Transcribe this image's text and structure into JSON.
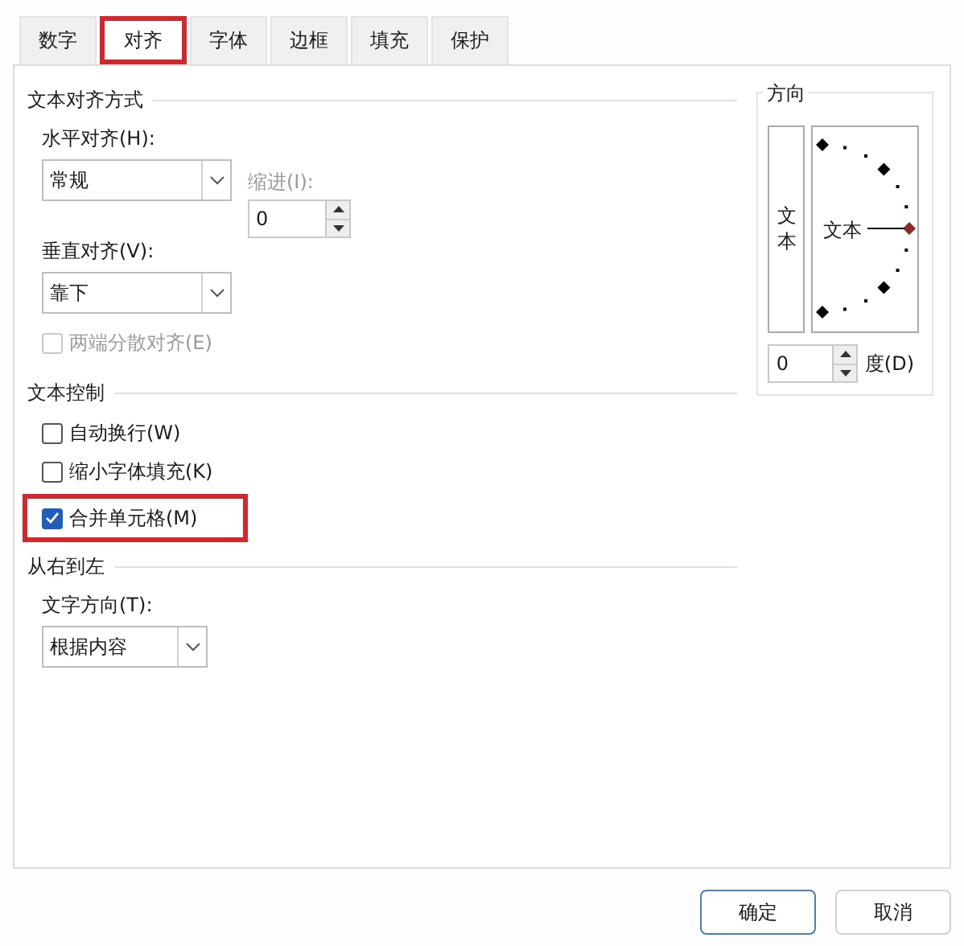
{
  "tabs": [
    {
      "label": "数字",
      "selected": false,
      "highlighted": false
    },
    {
      "label": "对齐",
      "selected": true,
      "highlighted": true
    },
    {
      "label": "字体",
      "selected": false,
      "highlighted": false
    },
    {
      "label": "边框",
      "selected": false,
      "highlighted": false
    },
    {
      "label": "填充",
      "selected": false,
      "highlighted": false
    },
    {
      "label": "保护",
      "selected": false,
      "highlighted": false
    }
  ],
  "text_alignment": {
    "title": "文本对齐方式",
    "horizontal": {
      "label": "水平对齐(H):",
      "value": "常规"
    },
    "indent": {
      "label": "缩进(I):",
      "value": "0",
      "disabled": true
    },
    "vertical": {
      "label": "垂直对齐(V):",
      "value": "靠下"
    },
    "distributed": {
      "label": "两端分散对齐(E)",
      "checked": false,
      "disabled": true,
      "highlighted": false
    }
  },
  "text_control": {
    "title": "文本控制",
    "options": [
      {
        "label": "自动换行(W)",
        "checked": false,
        "disabled": false,
        "highlighted": false
      },
      {
        "label": "缩小字体填充(K)",
        "checked": false,
        "disabled": false,
        "highlighted": false
      },
      {
        "label": "合并单元格(M)",
        "checked": true,
        "disabled": false,
        "highlighted": true
      }
    ]
  },
  "right_to_left": {
    "title": "从右到左",
    "direction": {
      "label": "文字方向(T):",
      "value": "根据内容"
    }
  },
  "orientation": {
    "title": "方向",
    "vertical_text": "文本",
    "dial_text": "文本",
    "degrees": {
      "value": "0",
      "unit": "度(D)"
    }
  },
  "buttons": [
    {
      "label": "确定",
      "kind": "primary"
    },
    {
      "label": "取消",
      "kind": "secondary"
    }
  ]
}
